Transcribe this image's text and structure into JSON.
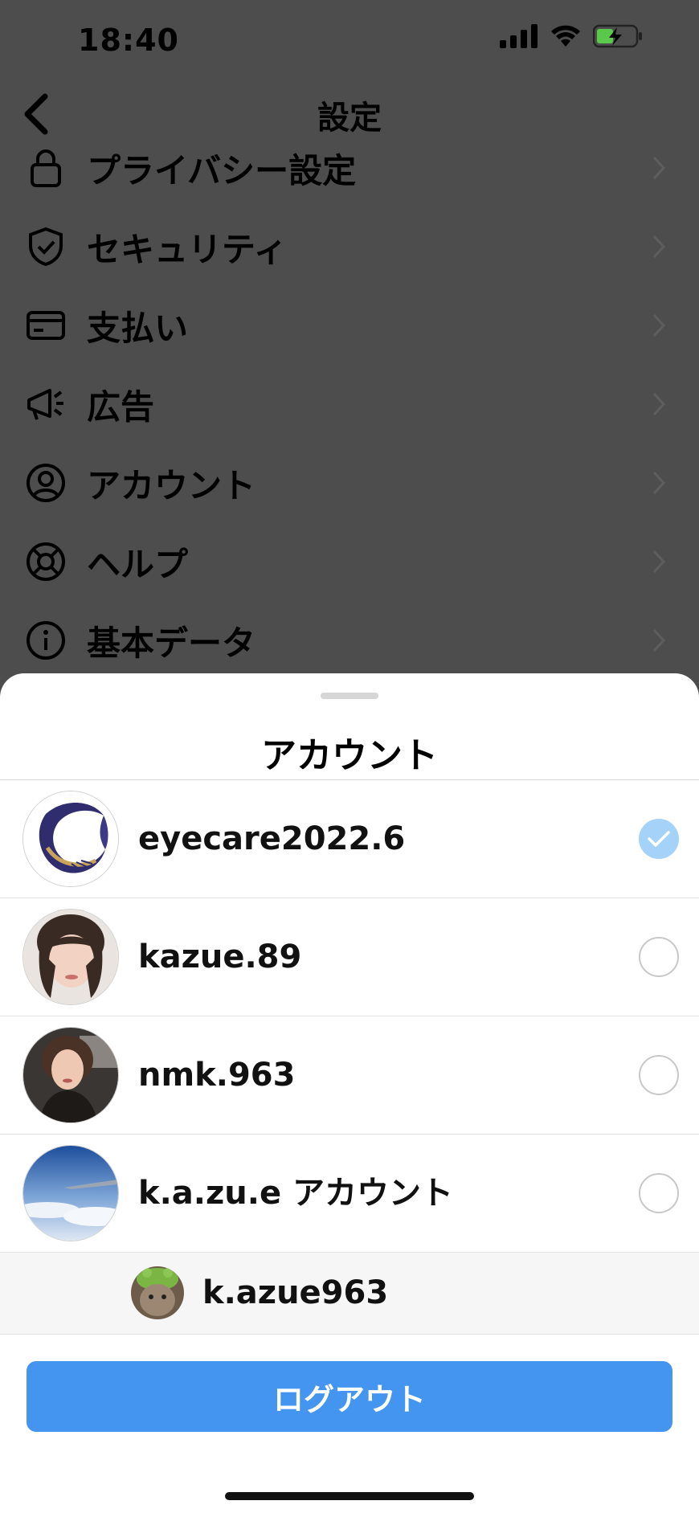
{
  "status_bar": {
    "time": "18:40"
  },
  "nav": {
    "title": "設定"
  },
  "menu": [
    {
      "label": "プライバシー設定",
      "icon": "lock-icon"
    },
    {
      "label": "セキュリティ",
      "icon": "shield-icon"
    },
    {
      "label": "支払い",
      "icon": "card-icon"
    },
    {
      "label": "広告",
      "icon": "megaphone-icon"
    },
    {
      "label": "アカウント",
      "icon": "person-circle-icon"
    },
    {
      "label": "ヘルプ",
      "icon": "lifebuoy-icon"
    },
    {
      "label": "基本データ",
      "icon": "info-icon"
    }
  ],
  "sheet": {
    "title": "アカウント",
    "accounts": [
      {
        "name": "eyecare2022.6",
        "selected": true
      },
      {
        "name": "kazue.89",
        "selected": false
      },
      {
        "name": "nmk.963",
        "selected": false
      },
      {
        "name": "k.a.zu.e アカウント",
        "selected": false
      }
    ],
    "sub_account": {
      "name": "k.azue963"
    },
    "logout_label": "ログアウト"
  },
  "colors": {
    "accent": "#4495f0",
    "check_bg": "#a5d2f8",
    "overlay": "#4d4d4d"
  }
}
